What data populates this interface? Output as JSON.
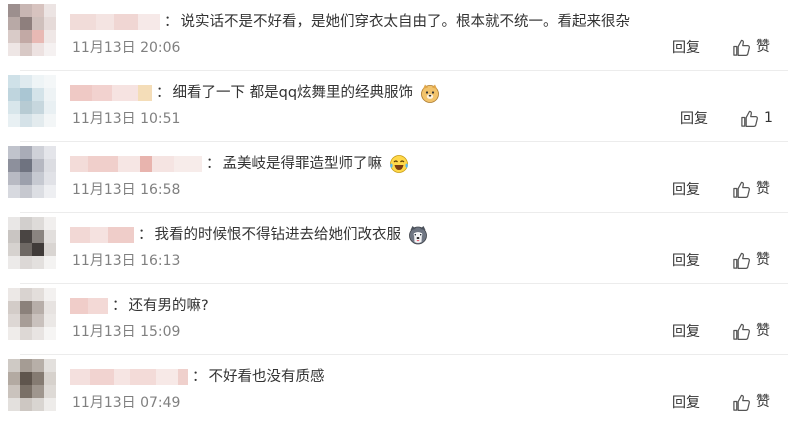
{
  "colors": {
    "text": "#333333",
    "meta": "#808080",
    "divider": "#ececec"
  },
  "comments": [
    {
      "username_blurred": true,
      "text": "说实话不是不好看，是她们穿衣太自由了。根本就不统一。看起来很杂",
      "emoji": null,
      "date": "11月13日 20:06",
      "reply_label": "回复",
      "like_label": "赞"
    },
    {
      "username_blurred": true,
      "text": "细看了一下 都是qq炫舞里的经典服饰",
      "emoji": "doge-face-icon",
      "date": "11月13日 10:51",
      "reply_label": "回复",
      "like_label": "1"
    },
    {
      "username_blurred": true,
      "text": "孟美岐是得罪造型师了嘛",
      "emoji": "laughing-tears-face-icon",
      "date": "11月13日 16:58",
      "reply_label": "回复",
      "like_label": "赞"
    },
    {
      "username_blurred": true,
      "text": "我看的时候恨不得钻进去给她们改衣服",
      "emoji": "husky-face-icon",
      "date": "11月13日 16:13",
      "reply_label": "回复",
      "like_label": "赞"
    },
    {
      "username_blurred": true,
      "text": "还有男的嘛?",
      "emoji": null,
      "date": "11月13日 15:09",
      "reply_label": "回复",
      "like_label": "赞"
    },
    {
      "username_blurred": true,
      "text": "不好看也没有质感",
      "emoji": null,
      "date": "11月13日 07:49",
      "reply_label": "回复",
      "like_label": "赞"
    }
  ],
  "colon": "："
}
